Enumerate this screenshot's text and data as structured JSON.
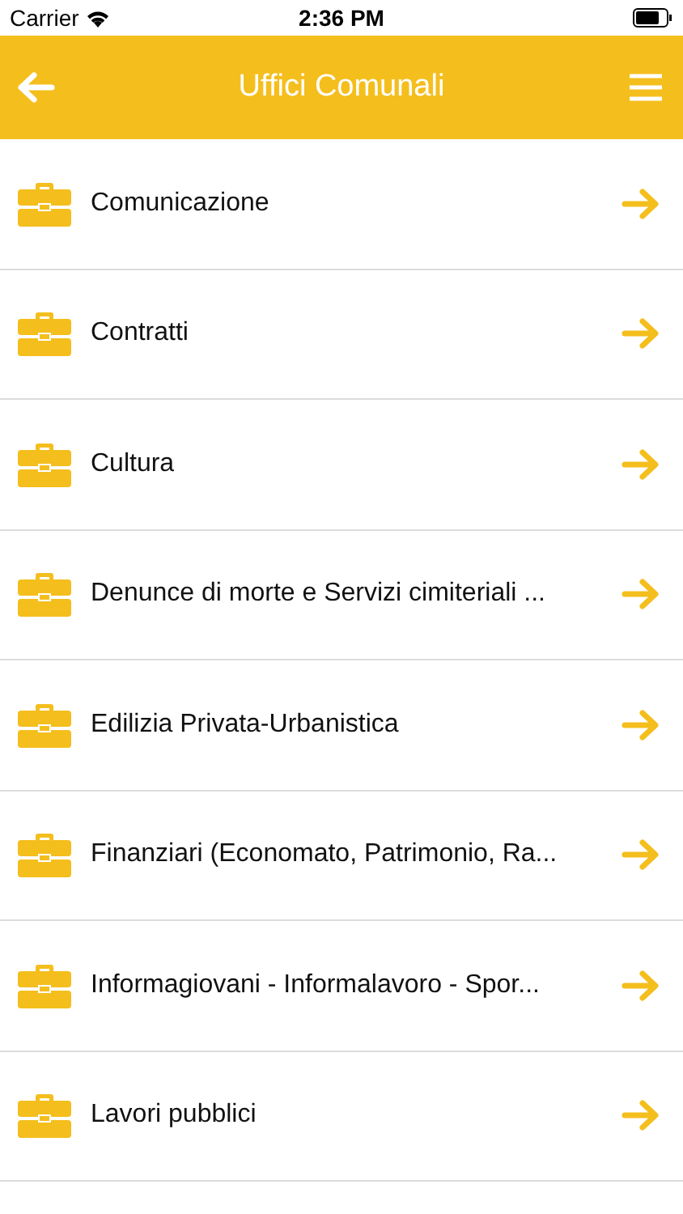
{
  "status_bar": {
    "carrier": "Carrier",
    "time": "2:36 PM"
  },
  "nav_bar": {
    "title": "Uffici Comunali"
  },
  "items": [
    {
      "label": "Comunicazione"
    },
    {
      "label": "Contratti"
    },
    {
      "label": "Cultura"
    },
    {
      "label": "Denunce di morte e Servizi cimiteriali ..."
    },
    {
      "label": "Edilizia Privata-Urbanistica"
    },
    {
      "label": "Finanziari (Economato, Patrimonio, Ra..."
    },
    {
      "label": "Informagiovani - Informalavoro - Spor..."
    },
    {
      "label": "Lavori pubblici"
    }
  ]
}
